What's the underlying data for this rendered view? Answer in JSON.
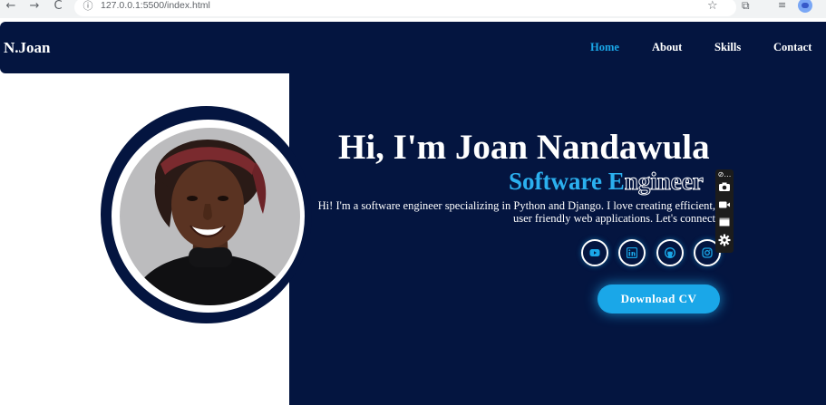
{
  "browser": {
    "url": "127.0.0.1:5500/index.html",
    "back_icon": "←",
    "forward_icon": "→",
    "reload_icon": "C",
    "info_icon": "ⓘ",
    "star_icon": "☆",
    "extensions_icon": "⧉",
    "media_icon": "≡"
  },
  "navbar": {
    "logo": "N.Joan",
    "links": [
      {
        "label": "Home",
        "active": true
      },
      {
        "label": "About",
        "active": false
      },
      {
        "label": "Skills",
        "active": false
      },
      {
        "label": "Contact",
        "active": false
      }
    ]
  },
  "hero": {
    "title": "Hi, I'm Joan Nandawula",
    "role_typed": "Software E",
    "role_ghost": "ngineer",
    "description": "Hi! I'm a software engineer specializing in Python and Django. I love creating efficient, user friendly web applications. Let's connect",
    "cv_button": "Download CV",
    "socials": [
      "youtube-icon",
      "linkedin-icon",
      "github-icon",
      "instagram-icon"
    ]
  },
  "colors": {
    "navy": "#041540",
    "accent": "#1aa7e8",
    "white": "#ffffff"
  },
  "ext_toolbar": {
    "handle": "⊘…",
    "icons": [
      "camera-icon",
      "video-icon",
      "window-icon",
      "gear-icon"
    ]
  }
}
